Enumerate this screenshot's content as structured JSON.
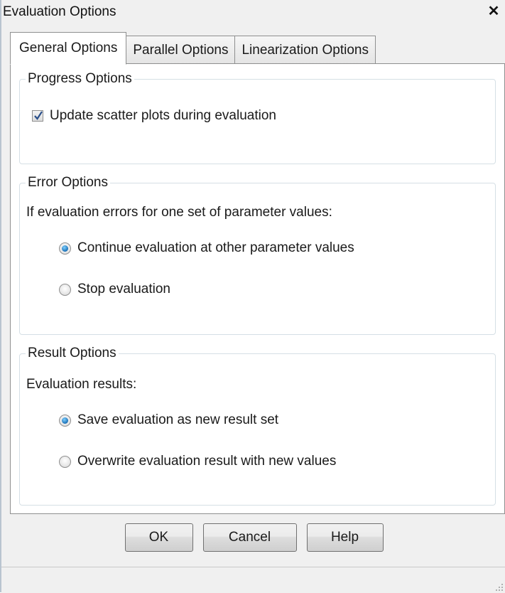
{
  "window": {
    "title": "Evaluation Options",
    "close_glyph": "✕"
  },
  "tabs": [
    {
      "label": "General Options",
      "active": true
    },
    {
      "label": "Parallel Options",
      "active": false
    },
    {
      "label": "Linearization Options",
      "active": false
    }
  ],
  "progress": {
    "legend": "Progress Options",
    "checkbox_label": "Update scatter plots during evaluation",
    "checked": true
  },
  "error": {
    "legend": "Error Options",
    "prompt": "If evaluation errors for one set of parameter values:",
    "options": [
      {
        "label": "Continue evaluation at other parameter values",
        "selected": true
      },
      {
        "label": "Stop evaluation",
        "selected": false
      }
    ]
  },
  "result": {
    "legend": "Result Options",
    "prompt": "Evaluation results:",
    "options": [
      {
        "label": "Save evaluation as new result set",
        "selected": true
      },
      {
        "label": "Overwrite evaluation result with new values",
        "selected": false
      }
    ]
  },
  "buttons": {
    "ok": "OK",
    "cancel": "Cancel",
    "help": "Help"
  },
  "colors": {
    "dialog_bg": "#f0f0f0",
    "panel_bg": "#ffffff",
    "radio_selected": "#1a6fb5"
  }
}
